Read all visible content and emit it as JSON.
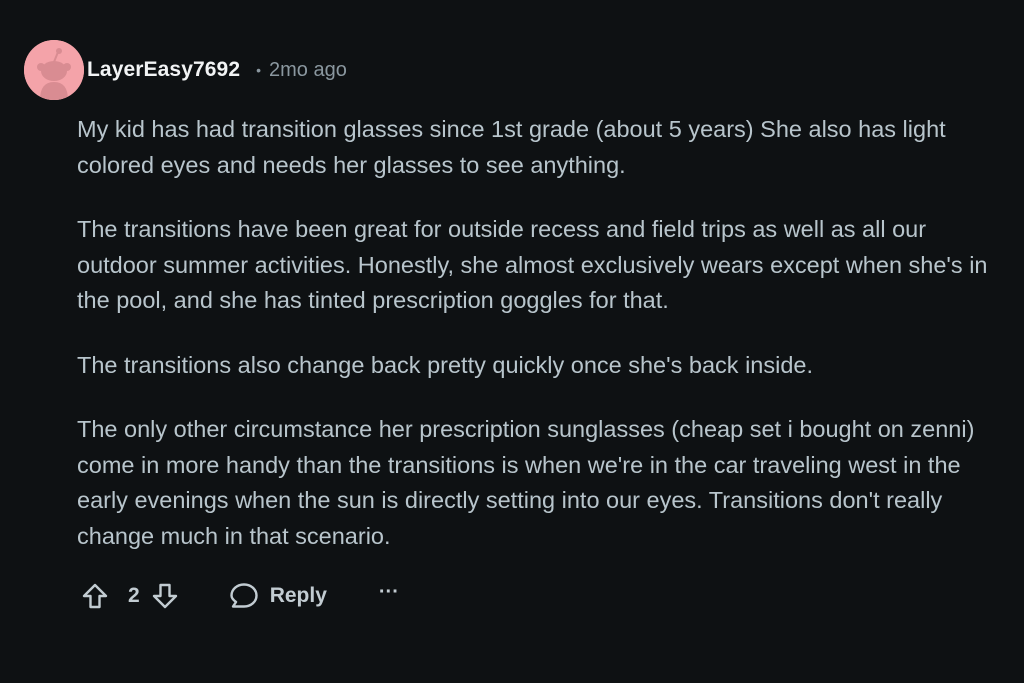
{
  "comment": {
    "author": "LayerEasy7692",
    "separator": "•",
    "timestamp": "2mo ago",
    "avatar_color": "#f4a3a9",
    "paragraphs": [
      "My kid has had transition glasses since 1st grade (about 5 years) She also has light colored eyes and needs her glasses to see anything.",
      "The transitions have been great for outside recess and field trips as well as all our outdoor summer activities. Honestly, she almost exclusively wears except when she's in the pool, and she has tinted prescription goggles for that.",
      "The transitions also change back pretty quickly once she's back inside.",
      "The only other circumstance her prescription sunglasses (cheap set i bought on zenni) come in more handy than the transitions is when we're in the car traveling west in the early evenings when the sun is directly setting into our eyes. Transitions don't really change much in that scenario."
    ]
  },
  "actions": {
    "upvote_icon": "upvote-arrow-icon",
    "vote_count": "2",
    "downvote_icon": "downvote-arrow-icon",
    "reply_icon": "speech-bubble-icon",
    "reply_label": "Reply",
    "more_label": "···"
  },
  "colors": {
    "background": "#0e1113",
    "text": "#b8c5cc",
    "username": "#f2f4f5",
    "meta": "#8a979f"
  }
}
